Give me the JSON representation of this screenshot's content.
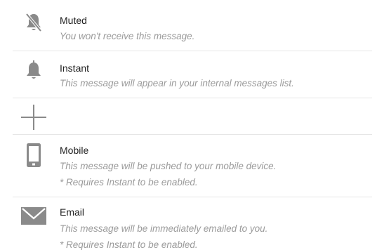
{
  "colors": {
    "icon": "#8a8a8a",
    "title": "#222222",
    "description": "#9a9a9a",
    "divider": "#e6e6e6"
  },
  "options": [
    {
      "icon": "muted-bell-icon",
      "title": "Muted",
      "description": "You won't receive this message.",
      "note": ""
    },
    {
      "icon": "bell-icon",
      "title": "Instant",
      "description": "This message will appear in your internal messages list.",
      "note": ""
    },
    {
      "icon": "plus-icon",
      "title": "",
      "description": "",
      "note": ""
    },
    {
      "icon": "mobile-device-icon",
      "title": "Mobile",
      "description": "This message will be pushed to your mobile device.",
      "note": "* Requires Instant to be enabled."
    },
    {
      "icon": "envelope-icon",
      "title": "Email",
      "description": "This message will be immediately emailed to you.",
      "note": "* Requires Instant to be enabled."
    }
  ]
}
